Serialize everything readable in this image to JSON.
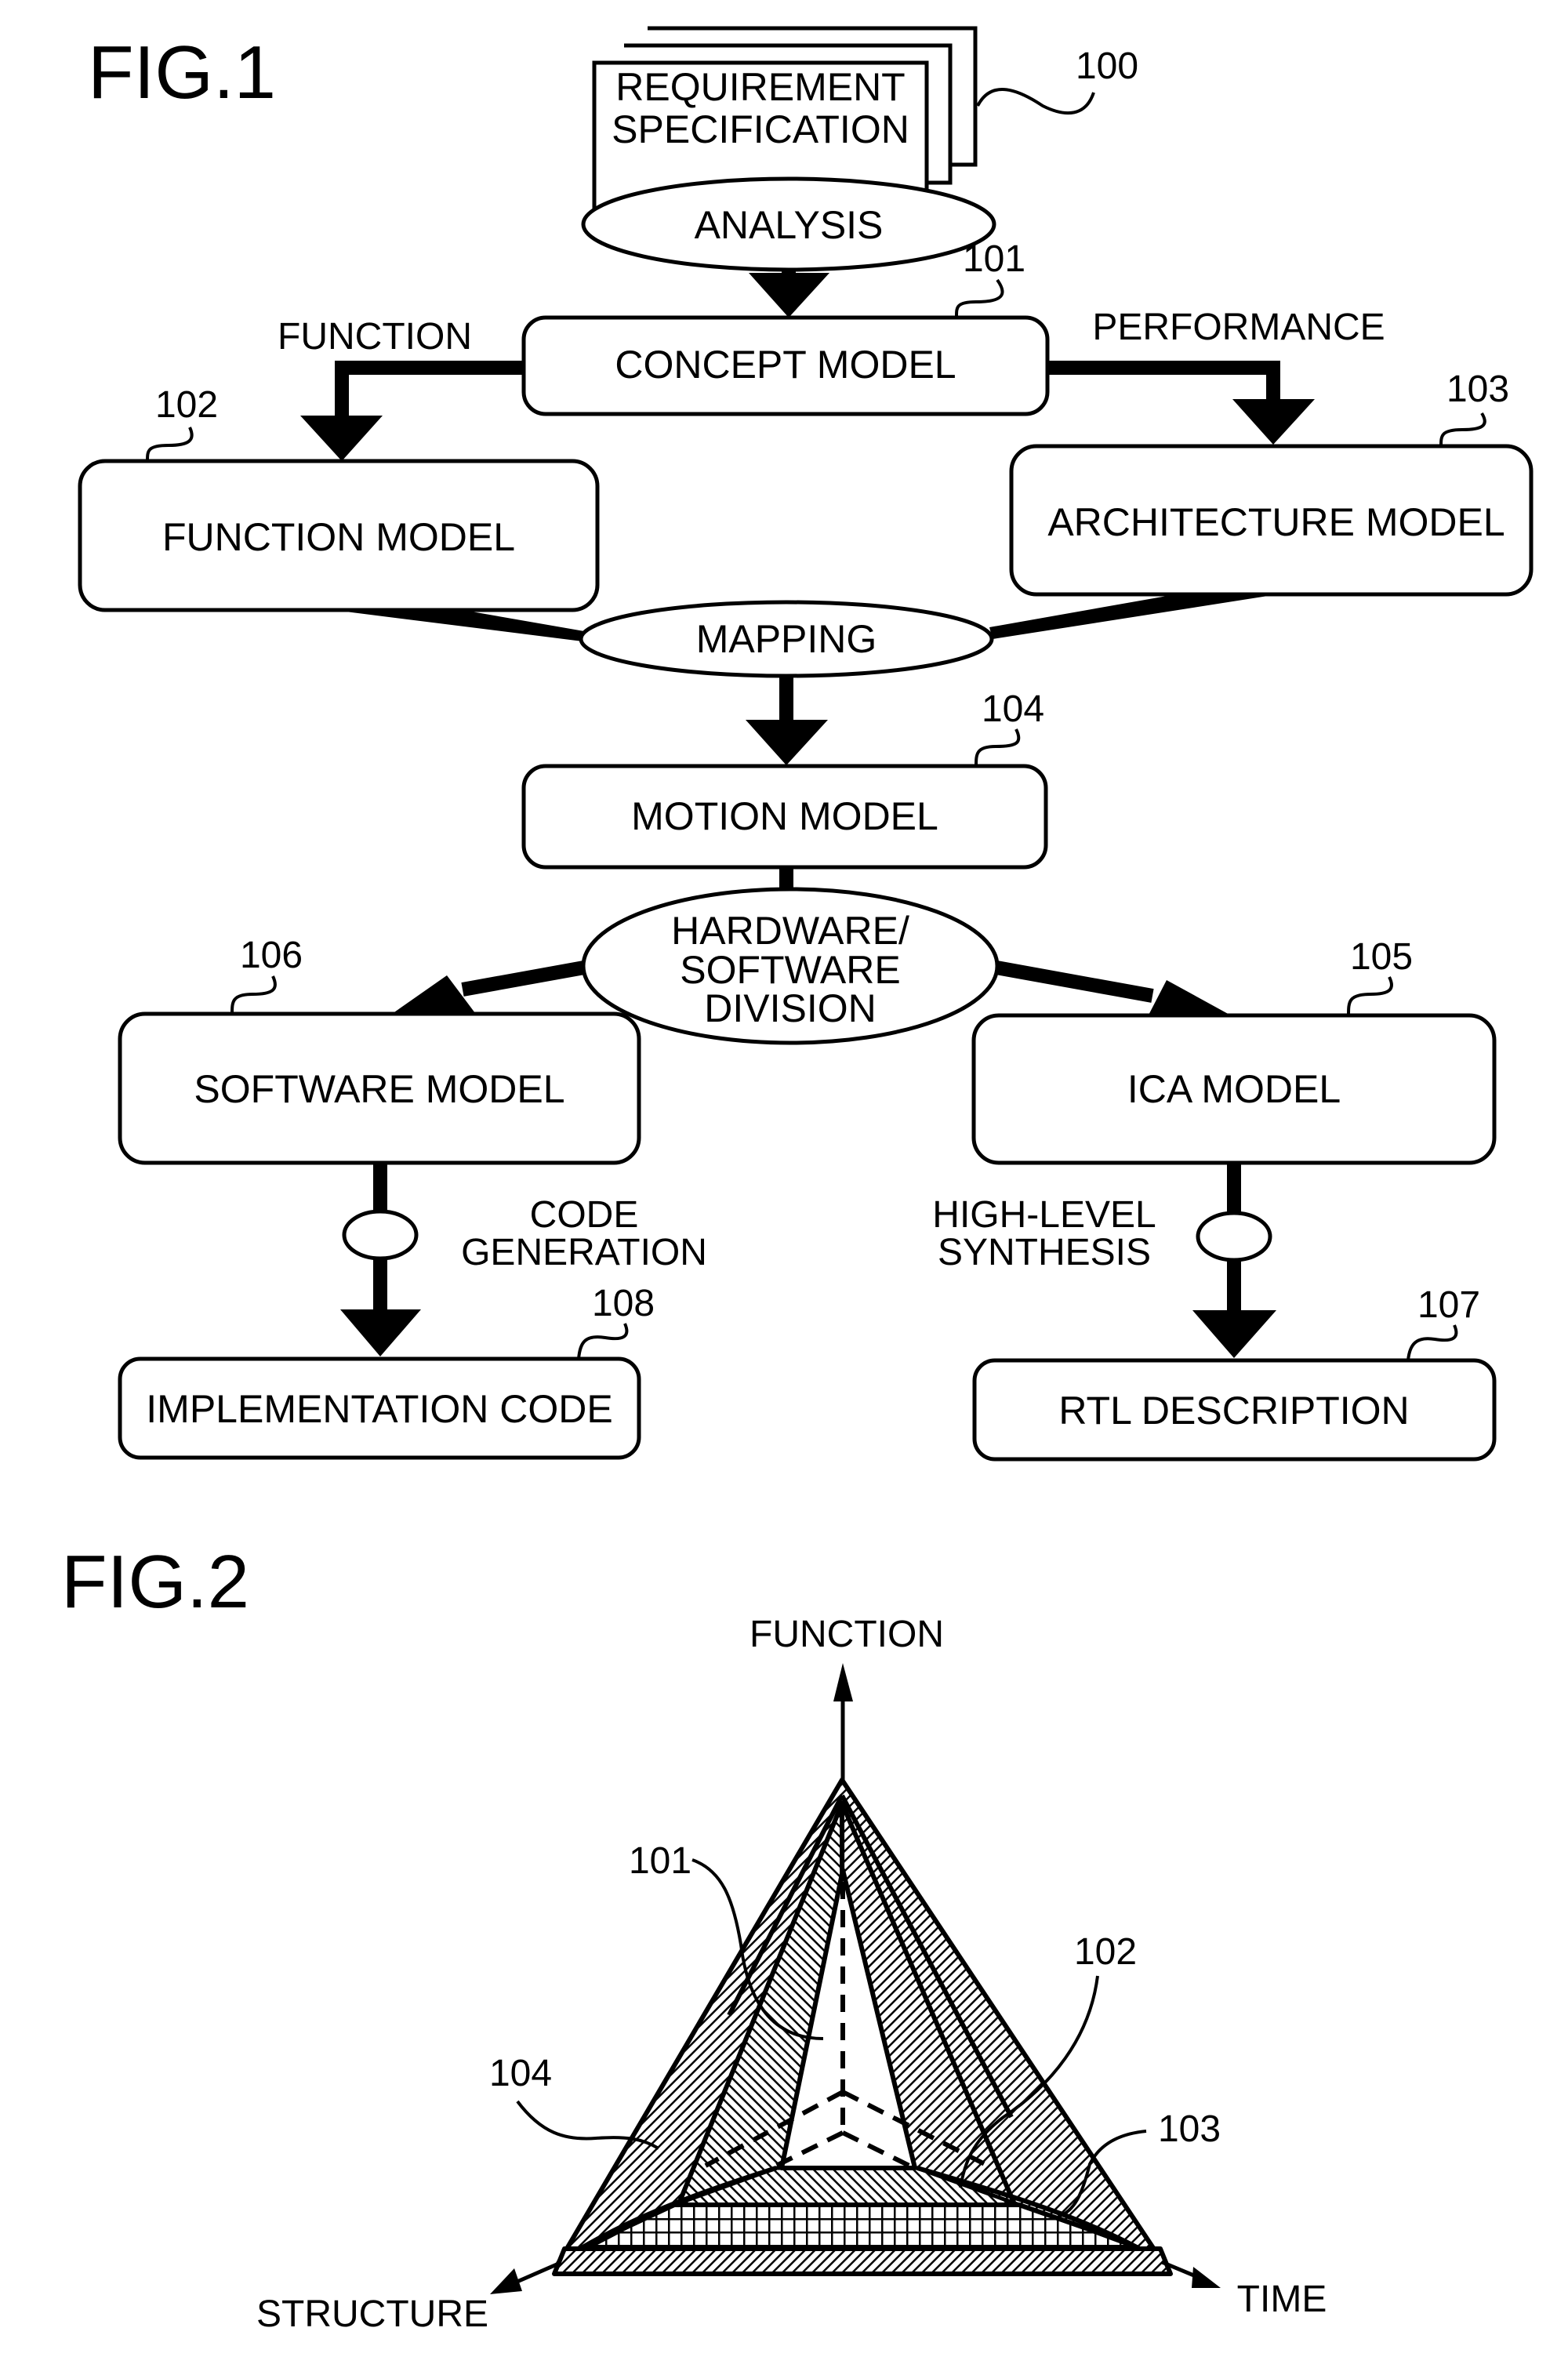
{
  "fig1": {
    "title": "FIG.1",
    "document": {
      "line1": "REQUIREMENT",
      "line2": "SPECIFICATION",
      "ref": "100"
    },
    "processes": {
      "analysis": "ANALYSIS",
      "mapping": "MAPPING",
      "division": {
        "line1": "HARDWARE/",
        "line2": "SOFTWARE",
        "line3": "DIVISION"
      }
    },
    "boxes": {
      "concept": {
        "label": "CONCEPT MODEL",
        "ref": "101"
      },
      "function": {
        "label": "FUNCTION MODEL",
        "ref": "102"
      },
      "architecture": {
        "label": "ARCHITECTURE MODEL",
        "ref": "103"
      },
      "motion": {
        "label": "MOTION MODEL",
        "ref": "104"
      },
      "ica": {
        "label": "ICA MODEL",
        "ref": "105"
      },
      "software": {
        "label": "SOFTWARE MODEL",
        "ref": "106"
      },
      "rtl": {
        "label": "RTL DESCRIPTION",
        "ref": "107"
      },
      "implementation": {
        "label": "IMPLEMENTATION CODE",
        "ref": "108"
      }
    },
    "edge_labels": {
      "function": "FUNCTION",
      "performance": "PERFORMANCE",
      "code_generation": {
        "line1": "CODE",
        "line2": "GENERATION"
      },
      "high_level_synthesis": {
        "line1": "HIGH-LEVEL",
        "line2": "SYNTHESIS"
      }
    }
  },
  "fig2": {
    "title": "FIG.2",
    "axes": {
      "function": "FUNCTION",
      "structure": "STRUCTURE",
      "time": "TIME"
    },
    "refs": {
      "concept": "101",
      "function": "102",
      "architecture": "103",
      "motion": "104"
    }
  }
}
